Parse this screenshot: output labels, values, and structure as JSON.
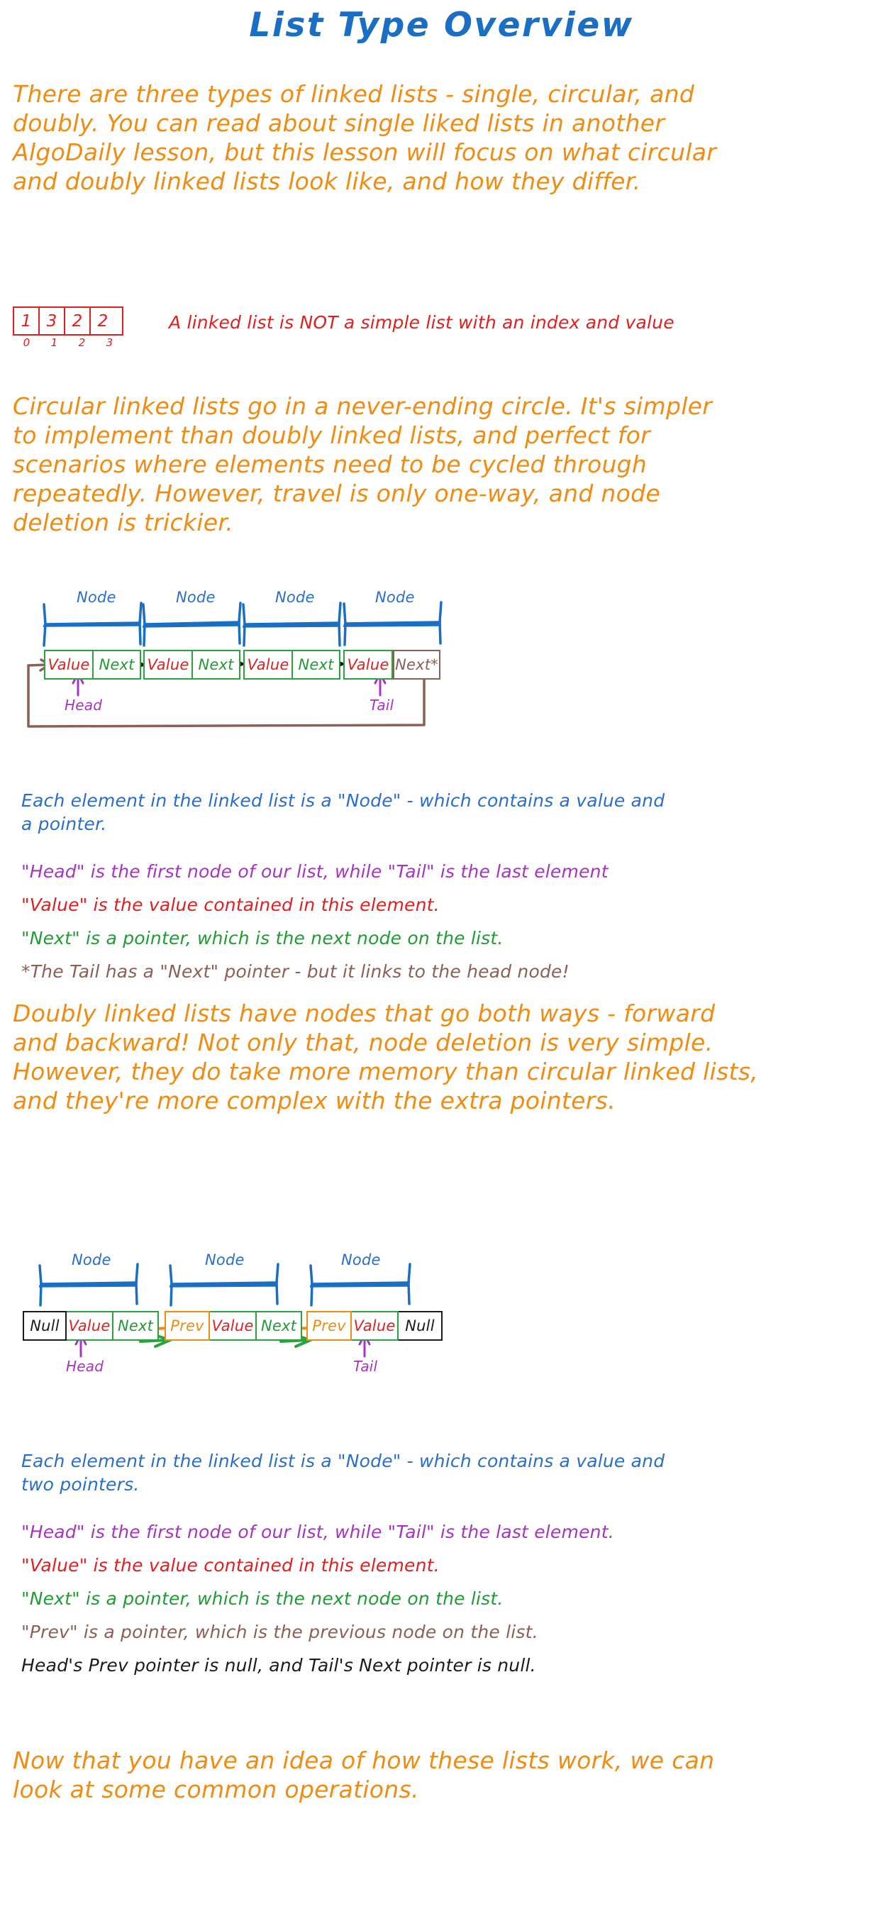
{
  "page": {
    "title": "List Type Overview",
    "background": "#ffffff"
  },
  "colors": {
    "title_blue": "#1a6fc4",
    "orange": "#f08c12",
    "blue": "#2a6ecb",
    "purple": "#a634c0",
    "red": "#e02020",
    "green": "#1f9c34",
    "green_border": "#2aa33f",
    "brown": "#8a6057",
    "black": "#1b1b1b"
  },
  "intro_paragraph": {
    "color": "#f08c12",
    "lines": [
      "There are three types of linked lists - single, circular, and",
      "doubly. You can read about single liked lists in another",
      "AlgoDaily lesson, but this lesson will focus on what circular",
      "and doubly linked lists look like, and how they differ."
    ]
  },
  "array_example": {
    "color": "#e02020",
    "values": [
      "1",
      "3",
      "2",
      "2"
    ],
    "indices": [
      "0",
      "1",
      "2",
      "3"
    ],
    "caption": "A linked list is NOT a simple list with an index and value"
  },
  "circular_paragraph": {
    "color": "#f08c12",
    "lines": [
      "Circular linked lists go in a never-ending circle. It's simpler",
      "to implement than doubly linked lists, and perfect for",
      "scenarios where elements need to be cycled through",
      "repeatedly. However, travel is only one-way, and node",
      "deletion is trickier."
    ]
  },
  "circular_diagram": {
    "node_bracket_label": "Node",
    "head_label": "Head",
    "tail_label": "Tail",
    "nodes": [
      {
        "cells": [
          {
            "text": "Value",
            "color": "#e02020",
            "border": "green"
          },
          {
            "text": "Next",
            "color": "#1f9c34",
            "border": "green"
          }
        ]
      },
      {
        "cells": [
          {
            "text": "Value",
            "color": "#e02020",
            "border": "green"
          },
          {
            "text": "Next",
            "color": "#1f9c34",
            "border": "green"
          }
        ]
      },
      {
        "cells": [
          {
            "text": "Value",
            "color": "#e02020",
            "border": "green"
          },
          {
            "text": "Next",
            "color": "#1f9c34",
            "border": "green"
          }
        ]
      },
      {
        "cells": [
          {
            "text": "Value",
            "color": "#e02020",
            "border": "green"
          },
          {
            "text": "Next*",
            "color": "#8a6057",
            "border": "brown"
          }
        ]
      }
    ]
  },
  "circular_notes": [
    {
      "color": "#2a6ecb",
      "lines": [
        "Each element in the linked list is a \"Node\" - which contains a value and",
        "a pointer."
      ]
    },
    {
      "color": "#a634c0",
      "lines": [
        "\"Head\" is the first node of our list, while \"Tail\" is the last element"
      ]
    },
    {
      "color": "#e02020",
      "lines": [
        "\"Value\" is the value contained in this element."
      ]
    },
    {
      "color": "#1f9c34",
      "lines": [
        "\"Next\" is a pointer, which is the next node on the list."
      ]
    },
    {
      "color": "#8a6057",
      "lines": [
        "*The Tail has a \"Next\" pointer - but it links to the head node!"
      ]
    }
  ],
  "doubly_paragraph": {
    "color": "#f08c12",
    "lines": [
      "Doubly linked lists have nodes that go both ways - forward",
      "and backward! Not only that, node deletion is very simple.",
      "However, they do take more memory than circular linked lists,",
      "and they're more complex with the extra pointers."
    ]
  },
  "doubly_diagram": {
    "node_bracket_label": "Node",
    "head_label": "Head",
    "tail_label": "Tail",
    "nodes": [
      {
        "cells": [
          {
            "text": "Null",
            "color": "#1b1b1b",
            "border": "black"
          },
          {
            "text": "Value",
            "color": "#e02020",
            "border": "green"
          },
          {
            "text": "Next",
            "color": "#1f9c34",
            "border": "green"
          }
        ]
      },
      {
        "cells": [
          {
            "text": "Prev",
            "color": "#f08c12",
            "border": "orange"
          },
          {
            "text": "Value",
            "color": "#e02020",
            "border": "green"
          },
          {
            "text": "Next",
            "color": "#1f9c34",
            "border": "green"
          }
        ]
      },
      {
        "cells": [
          {
            "text": "Prev",
            "color": "#f08c12",
            "border": "orange"
          },
          {
            "text": "Value",
            "color": "#e02020",
            "border": "green"
          },
          {
            "text": "Null",
            "color": "#1b1b1b",
            "border": "black"
          }
        ]
      }
    ]
  },
  "doubly_notes": [
    {
      "color": "#2a6ecb",
      "lines": [
        "Each element in the linked list is a \"Node\" - which contains a value and",
        "two pointers."
      ]
    },
    {
      "color": "#a634c0",
      "lines": [
        "\"Head\" is the first node of our list, while \"Tail\" is the last element."
      ]
    },
    {
      "color": "#e02020",
      "lines": [
        "\"Value\" is the value contained in this element."
      ]
    },
    {
      "color": "#1f9c34",
      "lines": [
        "\"Next\" is a pointer, which is the next node on the list."
      ]
    },
    {
      "color": "#8a6057",
      "lines": [
        "\"Prev\" is a pointer, which is the previous node on the list."
      ]
    },
    {
      "color": "#1b1b1b",
      "lines": [
        "Head's Prev pointer is null, and Tail's Next pointer is null."
      ]
    }
  ],
  "closing_paragraph": {
    "color": "#f08c12",
    "lines": [
      "Now that you have an idea of how these lists work, we can",
      "look at some common operations."
    ]
  }
}
